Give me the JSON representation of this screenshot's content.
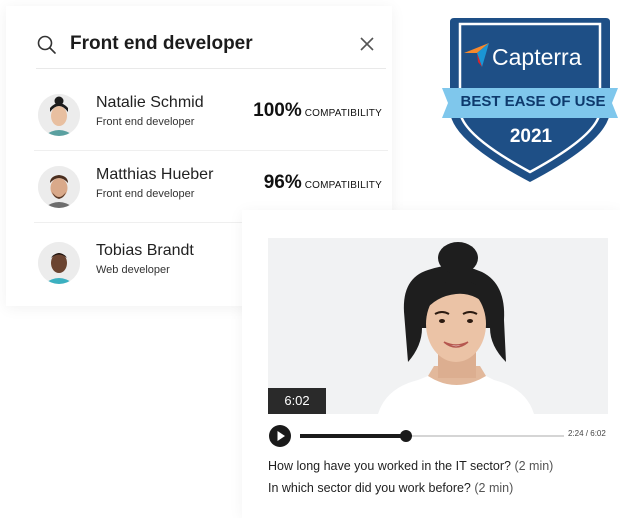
{
  "search": {
    "query": "Front end developer"
  },
  "candidates": [
    {
      "name": "Natalie Schmid",
      "role": "Front end developer",
      "score": "100%",
      "score_label": "COMPATIBILITY"
    },
    {
      "name": "Matthias Hueber",
      "role": "Front end developer",
      "score": "96%",
      "score_label": "COMPATIBILITY"
    },
    {
      "name": "Tobias Brandt",
      "role": "Web developer"
    }
  ],
  "badge": {
    "brand": "Capterra",
    "award": "BEST EASE OF USE",
    "year": "2021",
    "colors": {
      "shield": "#1e4f86",
      "ribbon": "#7fc7ec",
      "flag_orange": "#f7892c",
      "flag_red": "#d9242b",
      "flag_blue": "#1b95d4"
    }
  },
  "video": {
    "duration_badge": "6:02",
    "time_readout": "2:24 / 6:02",
    "progress": 0.4,
    "questions": [
      {
        "text": "How long have you worked in the IT sector?",
        "duration": "(2 min)"
      },
      {
        "text": "In which sector did you work before?",
        "duration": "(2 min)"
      }
    ]
  }
}
